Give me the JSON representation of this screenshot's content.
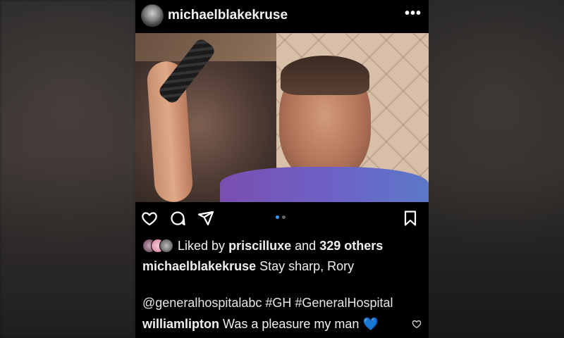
{
  "post": {
    "username": "michaelblakekruse",
    "more_icon": "more-horizontal-icon",
    "more_label": "•••"
  },
  "carousel": {
    "count": 2,
    "active_index": 0
  },
  "likes": {
    "prefix": "Liked by",
    "user": "priscilluxe",
    "middle": "and",
    "others": "329 others"
  },
  "caption": {
    "user": "michaelblakekruse",
    "text": "Stay sharp, Rory"
  },
  "hashtags": "@generalhospitalabc #GH #GeneralHospital",
  "comment": {
    "user": "williamlipton",
    "text": "Was a pleasure my man",
    "emoji": "💙"
  },
  "colors": {
    "background": "#000000",
    "text": "#f0f0f0",
    "carousel_active": "#3897f0",
    "carousel_inactive": "#666666"
  }
}
